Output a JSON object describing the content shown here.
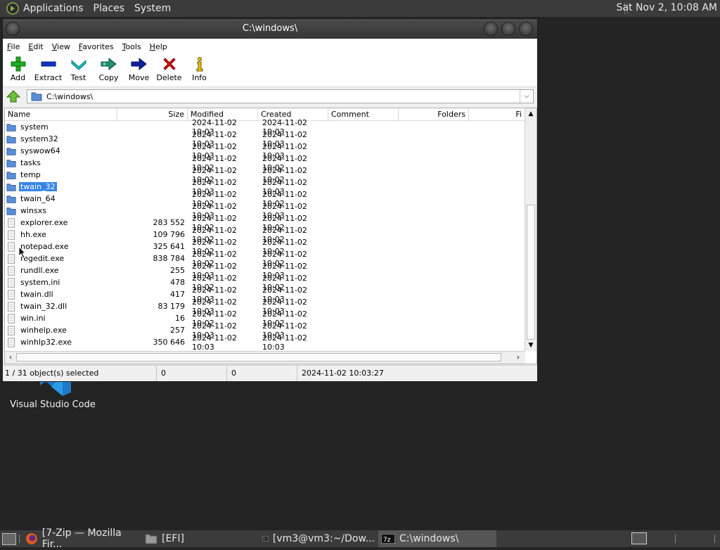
{
  "top_panel": {
    "menus": [
      "Applications",
      "Places",
      "System"
    ],
    "clock": "Sat Nov  2, 10:08 AM"
  },
  "desktop": {
    "icon_label": "Visual Studio Code"
  },
  "window": {
    "title": "C:\\windows\\",
    "menu": [
      "File",
      "Edit",
      "View",
      "Favorites",
      "Tools",
      "Help"
    ],
    "toolbar": [
      {
        "label": "Add",
        "icon": "plus-icon",
        "color": "#22aa22"
      },
      {
        "label": "Extract",
        "icon": "minus-icon",
        "color": "#1133cc"
      },
      {
        "label": "Test",
        "icon": "check-chevron-icon",
        "color": "#19b0b0"
      },
      {
        "label": "Copy",
        "icon": "double-arrow-right-icon",
        "color": "#1f8f6f"
      },
      {
        "label": "Move",
        "icon": "arrow-right-icon",
        "color": "#101f9a"
      },
      {
        "label": "Delete",
        "icon": "x-icon",
        "color": "#dd1111"
      },
      {
        "label": "Info",
        "icon": "info-icon",
        "color": "#c8a800"
      }
    ],
    "address": "C:\\windows\\",
    "columns": [
      "Name",
      "Size",
      "Modified",
      "Created",
      "Comment",
      "Folders",
      "Fi"
    ],
    "rows": [
      {
        "name": "system",
        "type": "folder",
        "size": "",
        "modified": "2024-11-02 10:03",
        "created": "2024-11-02 10:03"
      },
      {
        "name": "system32",
        "type": "folder",
        "size": "",
        "modified": "2024-11-02 10:03",
        "created": "2024-11-02 10:03"
      },
      {
        "name": "syswow64",
        "type": "folder",
        "size": "",
        "modified": "2024-11-02 10:03",
        "created": "2024-11-02 10:03"
      },
      {
        "name": "tasks",
        "type": "folder",
        "size": "",
        "modified": "2024-11-02 10:02",
        "created": "2024-11-02 10:02"
      },
      {
        "name": "temp",
        "type": "folder",
        "size": "",
        "modified": "2024-11-02 10:02",
        "created": "2024-11-02 10:02"
      },
      {
        "name": "twain_32",
        "type": "folder",
        "size": "",
        "modified": "2024-11-02 10:03",
        "created": "2024-11-02 10:03",
        "selected": true
      },
      {
        "name": "twain_64",
        "type": "folder",
        "size": "",
        "modified": "2024-11-02 10:02",
        "created": "2024-11-02 10:02"
      },
      {
        "name": "winsxs",
        "type": "folder",
        "size": "",
        "modified": "2024-11-02 10:03",
        "created": "2024-11-02 10:03"
      },
      {
        "name": "explorer.exe",
        "type": "file",
        "size": "283 552",
        "modified": "2024-11-02 10:02",
        "created": "2024-11-02 10:02"
      },
      {
        "name": "hh.exe",
        "type": "file",
        "size": "109 796",
        "modified": "2024-11-02 10:02",
        "created": "2024-11-02 10:02"
      },
      {
        "name": "notepad.exe",
        "type": "file",
        "size": "325 641",
        "modified": "2024-11-02 10:02",
        "created": "2024-11-02 10:02"
      },
      {
        "name": "regedit.exe",
        "type": "file",
        "size": "838 784",
        "modified": "2024-11-02 10:02",
        "created": "2024-11-02 10:02"
      },
      {
        "name": "rundll.exe",
        "type": "file",
        "size": "255",
        "modified": "2024-11-02 10:03",
        "created": "2024-11-02 10:03"
      },
      {
        "name": "system.ini",
        "type": "file",
        "size": "478",
        "modified": "2024-11-02 10:02",
        "created": "2024-11-02 10:02"
      },
      {
        "name": "twain.dll",
        "type": "file",
        "size": "417",
        "modified": "2024-11-02 10:03",
        "created": "2024-11-02 10:03"
      },
      {
        "name": "twain_32.dll",
        "type": "file",
        "size": "83 179",
        "modified": "2024-11-02 10:03",
        "created": "2024-11-02 10:03"
      },
      {
        "name": "win.ini",
        "type": "file",
        "size": "16",
        "modified": "2024-11-02 10:02",
        "created": "2024-11-02 10:02"
      },
      {
        "name": "winhelp.exe",
        "type": "file",
        "size": "257",
        "modified": "2024-11-02 10:03",
        "created": "2024-11-02 10:03"
      },
      {
        "name": "winhlp32.exe",
        "type": "file",
        "size": "350 646",
        "modified": "2024-11-02 10:03",
        "created": "2024-11-02 10:03"
      }
    ],
    "status": {
      "selection": "1 / 31 object(s) selected",
      "size": "0",
      "packed": "0",
      "date": "2024-11-02 10:03:27"
    }
  },
  "taskbar": {
    "tasks": [
      {
        "label": "[7-Zip — Mozilla Fir...",
        "icon": "firefox-icon"
      },
      {
        "label": "[EFI]",
        "icon": "folder-icon"
      },
      {
        "label": "[vm3@vm3:~/Dow...",
        "icon": "terminal-icon"
      },
      {
        "label": "C:\\windows\\",
        "icon": "7zip-icon",
        "active": true
      }
    ]
  },
  "colors": {
    "folder": "#5a8fd6",
    "selection": "#3584e4",
    "panel": "#3b3b3b"
  }
}
